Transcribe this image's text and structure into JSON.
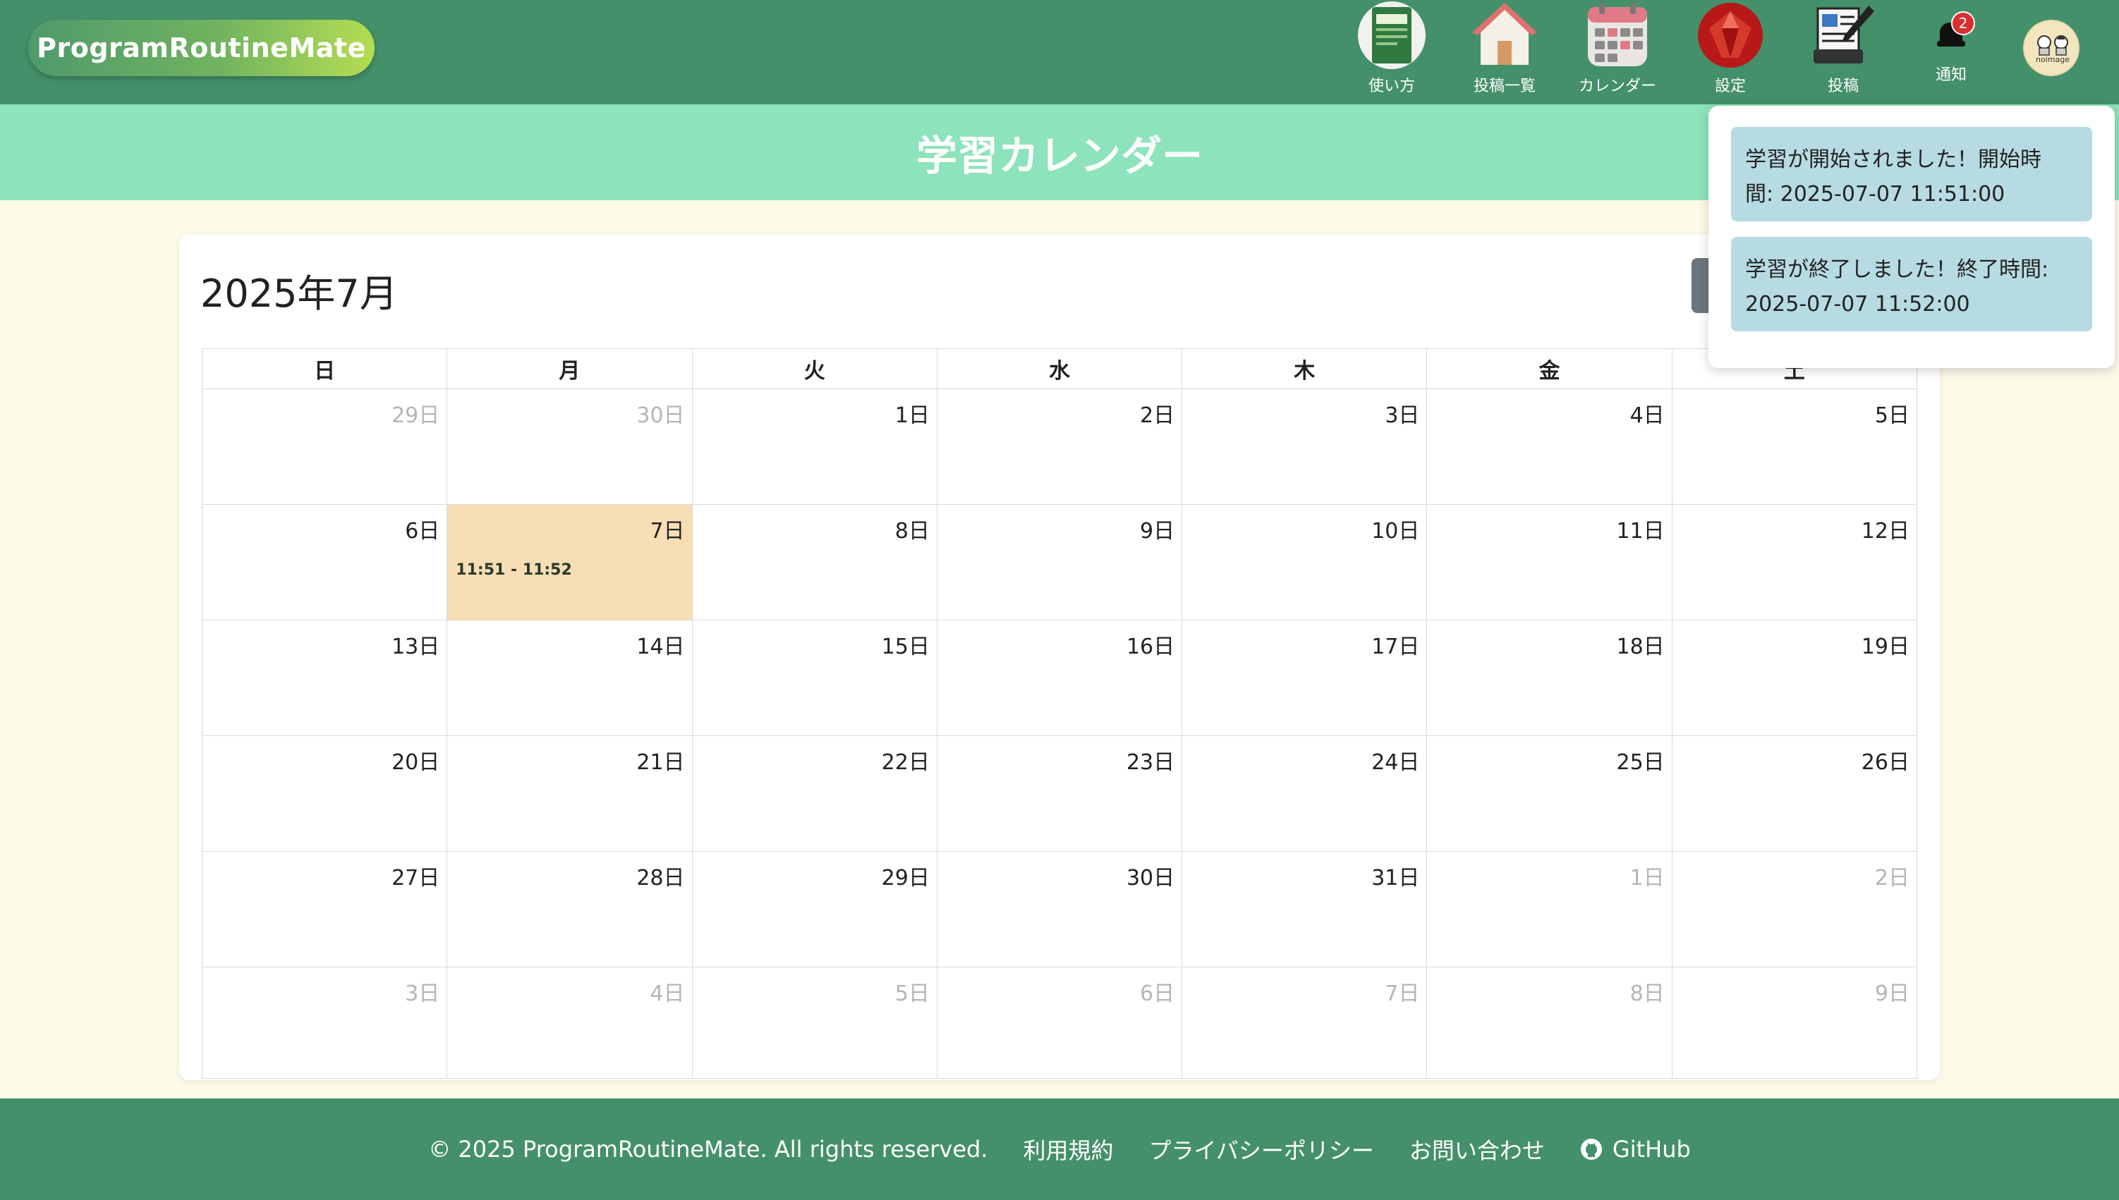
{
  "app": {
    "brand": "ProgramRoutineMate"
  },
  "nav": {
    "items": [
      {
        "label": "使い方",
        "icon": "book-icon"
      },
      {
        "label": "投稿一覧",
        "icon": "house-icon"
      },
      {
        "label": "カレンダー",
        "icon": "calendar-icon"
      },
      {
        "label": "設定",
        "icon": "ruby-gem-icon"
      },
      {
        "label": "投稿",
        "icon": "pen-and-paper-icon"
      }
    ],
    "notifications": {
      "label": "通知",
      "badge_count": "2",
      "icon": "bell-icon"
    },
    "avatar": {
      "text": "noimage"
    }
  },
  "page": {
    "title": "学習カレンダー"
  },
  "calendar": {
    "month_title": "2025年7月",
    "weekdays": [
      "日",
      "月",
      "火",
      "水",
      "木",
      "金",
      "土"
    ],
    "weeks": [
      [
        {
          "d": "29日",
          "o": true
        },
        {
          "d": "30日",
          "o": true
        },
        {
          "d": "1日"
        },
        {
          "d": "2日"
        },
        {
          "d": "3日"
        },
        {
          "d": "4日"
        },
        {
          "d": "5日"
        }
      ],
      [
        {
          "d": "6日"
        },
        {
          "d": "7日",
          "today": true,
          "event": "11:51 - 11:52"
        },
        {
          "d": "8日"
        },
        {
          "d": "9日"
        },
        {
          "d": "10日"
        },
        {
          "d": "11日"
        },
        {
          "d": "12日"
        }
      ],
      [
        {
          "d": "13日"
        },
        {
          "d": "14日"
        },
        {
          "d": "15日"
        },
        {
          "d": "16日"
        },
        {
          "d": "17日"
        },
        {
          "d": "18日"
        },
        {
          "d": "19日"
        }
      ],
      [
        {
          "d": "20日"
        },
        {
          "d": "21日"
        },
        {
          "d": "22日"
        },
        {
          "d": "23日"
        },
        {
          "d": "24日"
        },
        {
          "d": "25日"
        },
        {
          "d": "26日"
        }
      ],
      [
        {
          "d": "27日"
        },
        {
          "d": "28日"
        },
        {
          "d": "29日"
        },
        {
          "d": "30日"
        },
        {
          "d": "31日"
        },
        {
          "d": "1日",
          "o": true
        },
        {
          "d": "2日",
          "o": true
        }
      ],
      [
        {
          "d": "3日",
          "o": true
        },
        {
          "d": "4日",
          "o": true
        },
        {
          "d": "5日",
          "o": true
        },
        {
          "d": "6日",
          "o": true
        },
        {
          "d": "7日",
          "o": true
        },
        {
          "d": "8日",
          "o": true
        },
        {
          "d": "9日",
          "o": true
        }
      ]
    ]
  },
  "notifications_dropdown": {
    "items": [
      {
        "line1": "学習が開始されました！開始時",
        "line2": "間: 2025-07-07 11:51:00"
      },
      {
        "line1": "学習が終了しました！終了時間:",
        "line2": "2025-07-07 11:52:00"
      }
    ]
  },
  "footer": {
    "copyright": "© 2025 ProgramRoutineMate. All rights reserved.",
    "links": [
      "利用規約",
      "プライバシーポリシー",
      "お問い合わせ"
    ],
    "github": "GitHub"
  },
  "colors": {
    "header_bg": "#44906a",
    "title_bar_bg": "#8de3bb",
    "page_bg": "#fefaea",
    "today_bg": "#f8deb5",
    "notice_bg": "#b7dbe2",
    "badge": "#d92f2f"
  }
}
